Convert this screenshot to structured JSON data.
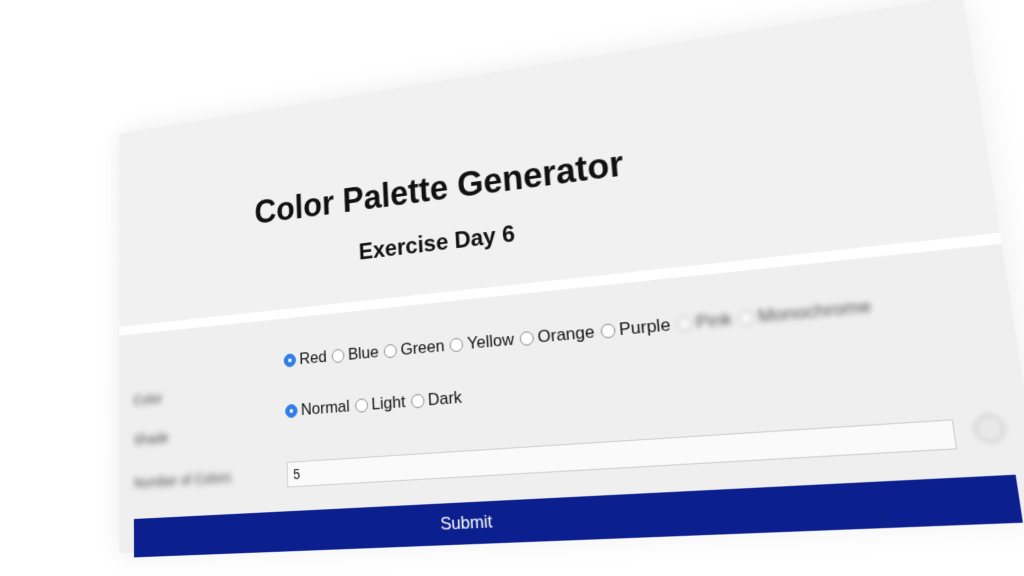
{
  "header": {
    "title": "Color Palette Generator",
    "subtitle": "Exercise Day 6"
  },
  "form": {
    "color_row": {
      "label": "Color",
      "options": [
        {
          "label": "Red",
          "checked": true
        },
        {
          "label": "Blue",
          "checked": false
        },
        {
          "label": "Green",
          "checked": false
        },
        {
          "label": "Yellow",
          "checked": false
        },
        {
          "label": "Orange",
          "checked": false
        },
        {
          "label": "Purple",
          "checked": false
        },
        {
          "label": "Pink",
          "checked": false
        },
        {
          "label": "Monochrome",
          "checked": false
        }
      ]
    },
    "shade_row": {
      "label": "Shade",
      "options": [
        {
          "label": "Normal",
          "checked": true
        },
        {
          "label": "Light",
          "checked": false
        },
        {
          "label": "Dark",
          "checked": false
        }
      ]
    },
    "count_row": {
      "label": "Number of Colors",
      "value": "5"
    },
    "submit_label": "Submit"
  },
  "colors": {
    "submit_bg": "#0b1f8f",
    "radio_checked": "#2f7ee6",
    "page_bg": "#f1f1f1"
  }
}
